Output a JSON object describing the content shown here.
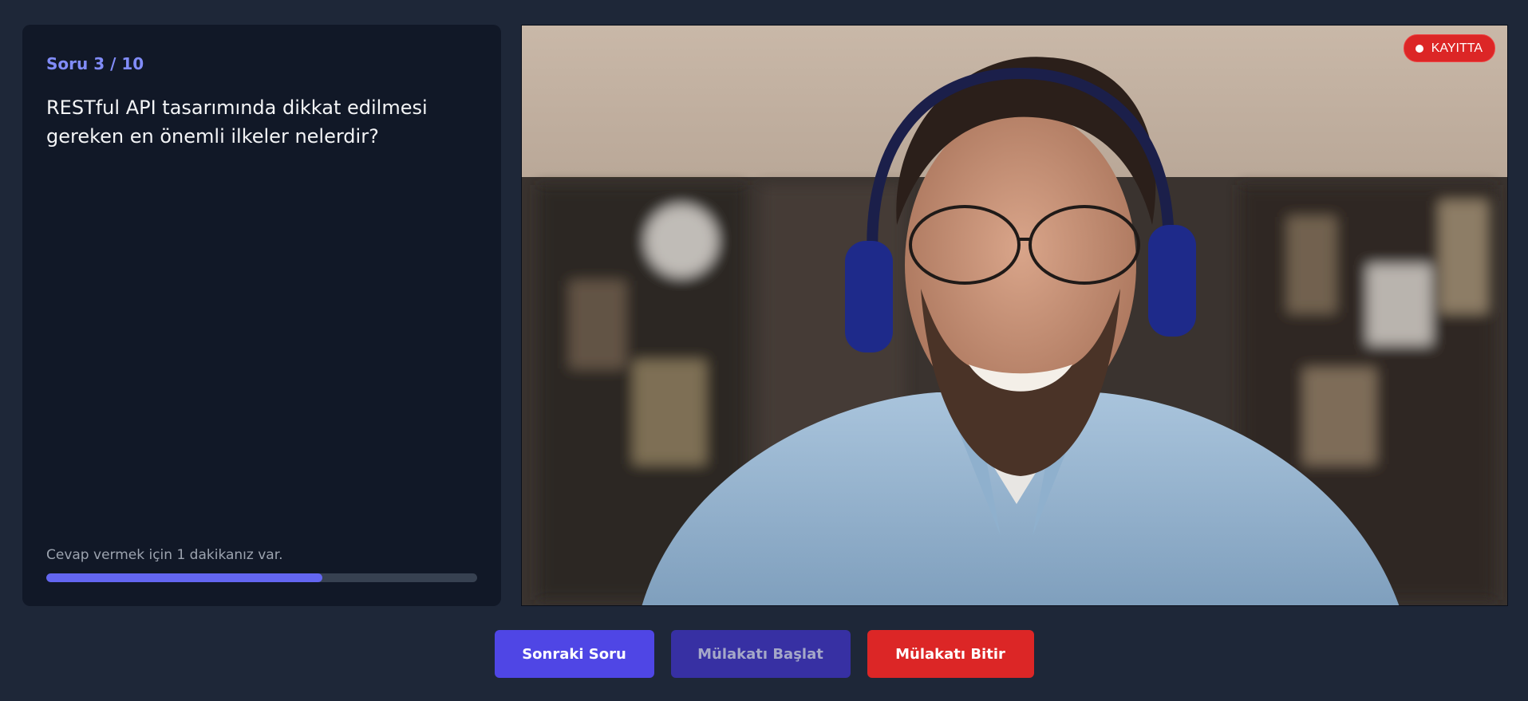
{
  "question": {
    "counter": "Soru 3 / 10",
    "text": "RESTful API tasarımında dikkat edilmesi gereken en önemli ilkeler nelerdir?",
    "timer_hint": "Cevap vermek için 1 dakikanız var.",
    "progress": 0.64
  },
  "video": {
    "recording_label": "KAYITTA"
  },
  "controls": {
    "next_label": "Sonraki Soru",
    "start_label": "Mülakatı Başlat",
    "end_label": "Mülakatı Bitir"
  },
  "colors": {
    "accent": "#6366f1",
    "danger": "#dc2626",
    "background": "#1e2738",
    "panel": "#111827"
  }
}
